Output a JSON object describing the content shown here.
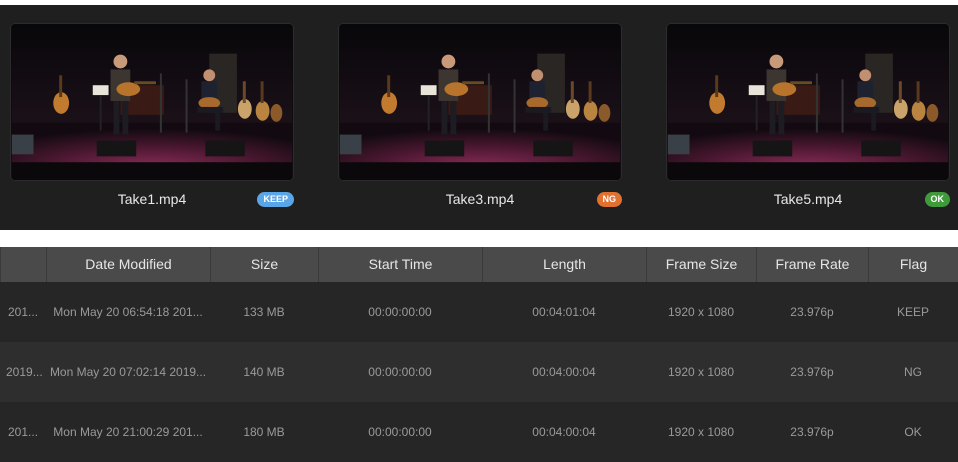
{
  "thumbnails": [
    {
      "name": "Take1.mp4",
      "flag": "KEEP",
      "flag_color": "#58a6e8"
    },
    {
      "name": "Take3.mp4",
      "flag": "NG",
      "flag_color": "#e2702f"
    },
    {
      "name": "Take5.mp4",
      "flag": "OK",
      "flag_color": "#3f9a3a"
    }
  ],
  "table": {
    "headers": [
      "Date Modified",
      "Size",
      "Start Time",
      "Length",
      "Frame Size",
      "Frame Rate",
      "Flag"
    ],
    "rows": [
      {
        "name_fragment": "201...",
        "date": "Mon May 20 06:54:18 201...",
        "size": "133 MB",
        "start": "00:00:00:00",
        "length": "00:04:01:04",
        "frame_size": "1920 x 1080",
        "frame_rate": "23.976p",
        "flag": "KEEP"
      },
      {
        "name_fragment": "2019...",
        "date": "Mon May 20 07:02:14 2019...",
        "size": "140 MB",
        "start": "00:00:00:00",
        "length": "00:04:00:04",
        "frame_size": "1920 x 1080",
        "frame_rate": "23.976p",
        "flag": "NG"
      },
      {
        "name_fragment": "201...",
        "date": "Mon May 20 21:00:29 201...",
        "size": "180 MB",
        "start": "00:00:00:00",
        "length": "00:04:00:04",
        "frame_size": "1920 x 1080",
        "frame_rate": "23.976p",
        "flag": "OK"
      }
    ]
  },
  "colors": {
    "strip_bg": "#1f1f1f",
    "header_bg": "#4a4a4a",
    "row_odd": "#262626",
    "row_even": "#2e2e2e"
  }
}
